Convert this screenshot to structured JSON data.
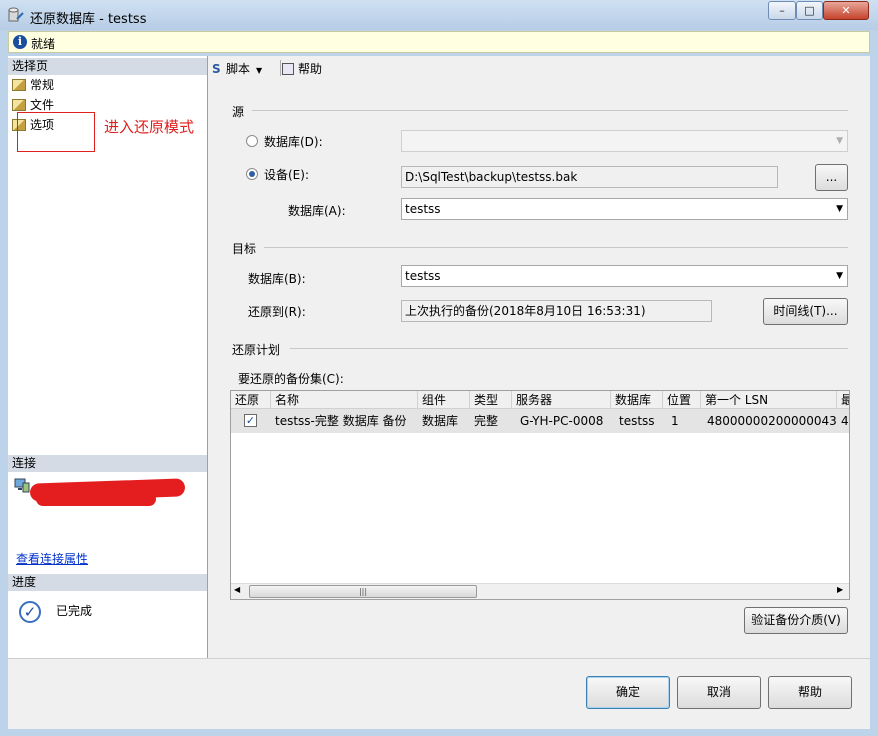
{
  "window": {
    "title": "还原数据库 - testss",
    "controls": {
      "minimize": "–",
      "maximize": "□",
      "close": "✕"
    }
  },
  "status": {
    "text": "就绪"
  },
  "left_panel": {
    "select_page_header": "选择页",
    "pages": [
      {
        "label": "常规"
      },
      {
        "label": "文件"
      },
      {
        "label": "选项"
      }
    ],
    "annotation": "进入还原模式",
    "connection_header": "连接",
    "connection_link": "查看连接属性",
    "progress_header": "进度",
    "progress_status": "已完成"
  },
  "toolbar": {
    "script_label": "脚本",
    "help_label": "帮助"
  },
  "source": {
    "title": "源",
    "database_radio_label": "数据库(D):",
    "device_radio_label": "设备(E):",
    "device_value": "D:\\SqlTest\\backup\\testss.bak",
    "browse_label": "...",
    "database_label": "数据库(A):",
    "database_value": "testss"
  },
  "target": {
    "title": "目标",
    "database_label": "数据库(B):",
    "database_value": "testss",
    "restore_to_label": "还原到(R):",
    "restore_to_value": "上次执行的备份(2018年8月10日 16:53:31)",
    "timeline_button": "时间线(T)..."
  },
  "plan": {
    "title": "还原计划",
    "backup_sets_label": "要还原的备份集(C):",
    "columns": [
      "还原",
      "名称",
      "组件",
      "类型",
      "服务器",
      "数据库",
      "位置",
      "第一个 LSN",
      "最"
    ],
    "rows": [
      {
        "restore": true,
        "name": "testss-完整 数据库 备份",
        "component": "数据库",
        "type": "完整",
        "server": "G-YH-PC-0008",
        "database": "testss",
        "position": "1",
        "first_lsn": "48000000200000043",
        "last_partial": "4"
      }
    ],
    "verify_button": "验证备份介质(V)"
  },
  "buttons": {
    "ok": "确定",
    "cancel": "取消",
    "help": "帮助"
  },
  "colors": {
    "accent": "#3c7fb1",
    "annotation": "#e02020",
    "link": "#0033cc",
    "redaction": "#e41e1e"
  }
}
